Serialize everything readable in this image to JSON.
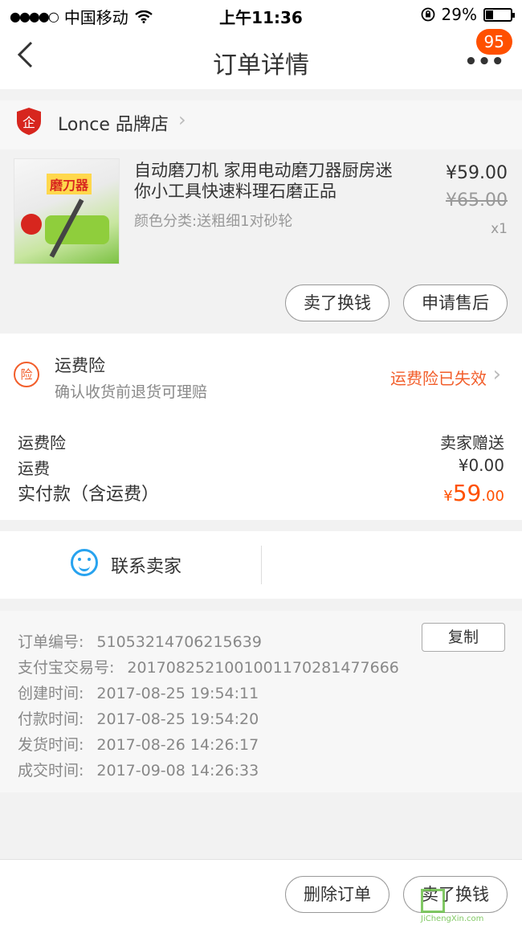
{
  "status_bar": {
    "signal": "●●●●○",
    "carrier": "中国移动",
    "time": "上午11:36",
    "battery": "29%",
    "battery_level": 0.29
  },
  "nav": {
    "back_icon": "chevron-left",
    "title": "订单详情",
    "more_icon": "•••",
    "badge": "95"
  },
  "shop": {
    "name": "Lonce 品牌店",
    "logo_text": "企",
    "chevron": "›"
  },
  "product": {
    "title": "自动磨刀机 家用电动磨刀器厨房迷你小工具快速料理石磨正品",
    "spec": "颜色分类:送粗细1对砂轮",
    "price": "¥59.00",
    "original_price": "¥65.00",
    "quantity": "x1",
    "thumb_tag": "磨刀器",
    "buttons": [
      "卖了换钱",
      "申请售后"
    ]
  },
  "insurance": {
    "icon_text": "险",
    "title": "运费险",
    "subtitle": "确认收货前退货可理赔",
    "status": "运费险已失效"
  },
  "fees": {
    "insurance_label": "运费险",
    "insurance_value": "卖家赠送",
    "shipping_label": "运费",
    "shipping_value": "¥0.00",
    "total_label": "实付款（含运费）",
    "total_currency": "¥",
    "total_int": "59",
    "total_dec": ".00"
  },
  "contact": {
    "label": "联系卖家"
  },
  "order_info": {
    "copy_button": "复制",
    "lines": [
      {
        "label": "订单编号:",
        "value": "51053214706215639"
      },
      {
        "label": "支付宝交易号:",
        "value": "2017082521001001170281477666"
      },
      {
        "label": "创建时间:",
        "value": "2017-08-25 19:54:11"
      },
      {
        "label": "付款时间:",
        "value": "2017-08-25 19:54:20"
      },
      {
        "label": "发货时间:",
        "value": "2017-08-26 14:26:17"
      },
      {
        "label": "成交时间:",
        "value": "2017-09-08 14:26:33"
      }
    ]
  },
  "bottom_bar": {
    "buttons": [
      "删除订单",
      "卖了换钱"
    ]
  },
  "watermark": {
    "text": "JiChengXin.com"
  },
  "colors": {
    "accent": "#ff5000",
    "insurance": "#f25e2b",
    "contact": "#28a3ef"
  }
}
